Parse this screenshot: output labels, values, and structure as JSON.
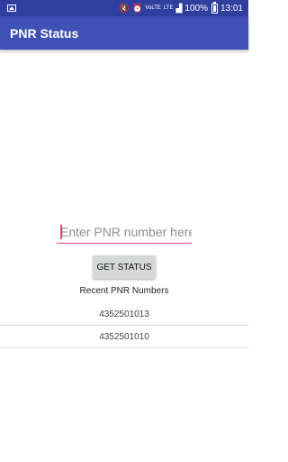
{
  "status_bar": {
    "notification_icon": "image-icon",
    "volte": "VoLTE",
    "lte": "LTE",
    "battery_percent": "100%",
    "time": "13:01"
  },
  "app_bar": {
    "title": "PNR Status",
    "color": "#3f51b5"
  },
  "form": {
    "input_value": "",
    "input_placeholder": "Enter PNR number here",
    "accent_color": "#e0457b",
    "button_label": "GET STATUS"
  },
  "recent": {
    "title": "Recent PNR Numbers",
    "items": [
      "4352501013",
      "4352501010"
    ]
  }
}
